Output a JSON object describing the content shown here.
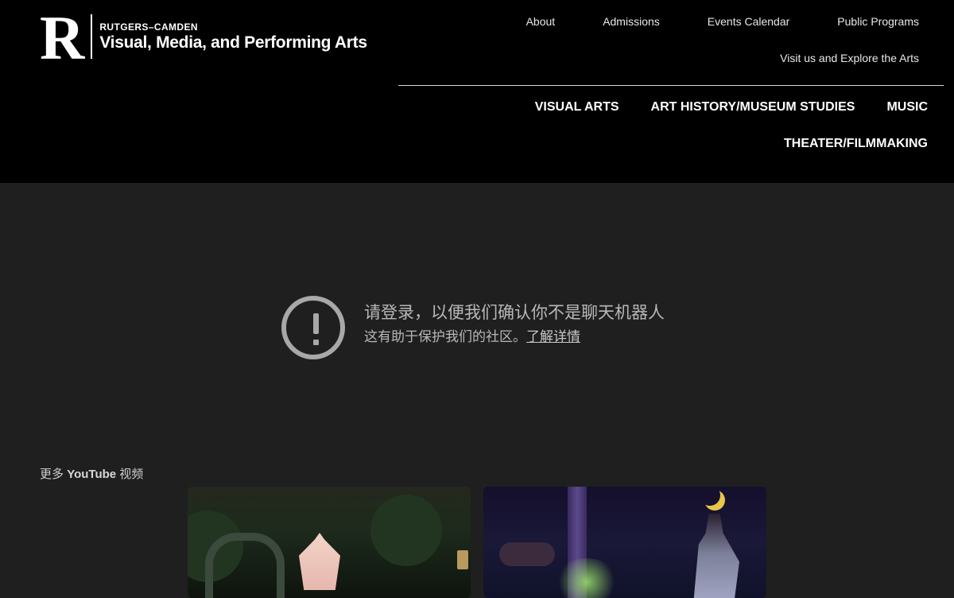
{
  "header": {
    "logo_letter": "R",
    "logo_small": "RUTGERS–CAMDEN",
    "logo_big": "Visual, Media, and Performing Arts",
    "utility_nav": [
      "About",
      "Admissions",
      "Events Calendar",
      "Public Programs"
    ],
    "utility_nav_row2": "Visit us and Explore the Arts",
    "main_nav": [
      "VISUAL ARTS",
      "ART HISTORY/MUSEUM STUDIES",
      "MUSIC"
    ],
    "main_nav_row2": "THEATER/FILMMAKING"
  },
  "notice": {
    "icon": "alert-circle-icon",
    "title": "请登录，以便我们确认你不是聊天机器人",
    "subtitle": "这有助于保护我们的社区。",
    "link": "了解详情"
  },
  "more_videos": {
    "prefix": "更多",
    "brand": "YouTube",
    "suffix": "视频"
  },
  "colors": {
    "header_bg": "#000000",
    "page_bg": "#1f1f1f",
    "notice_gray": "#a8a8a8"
  }
}
